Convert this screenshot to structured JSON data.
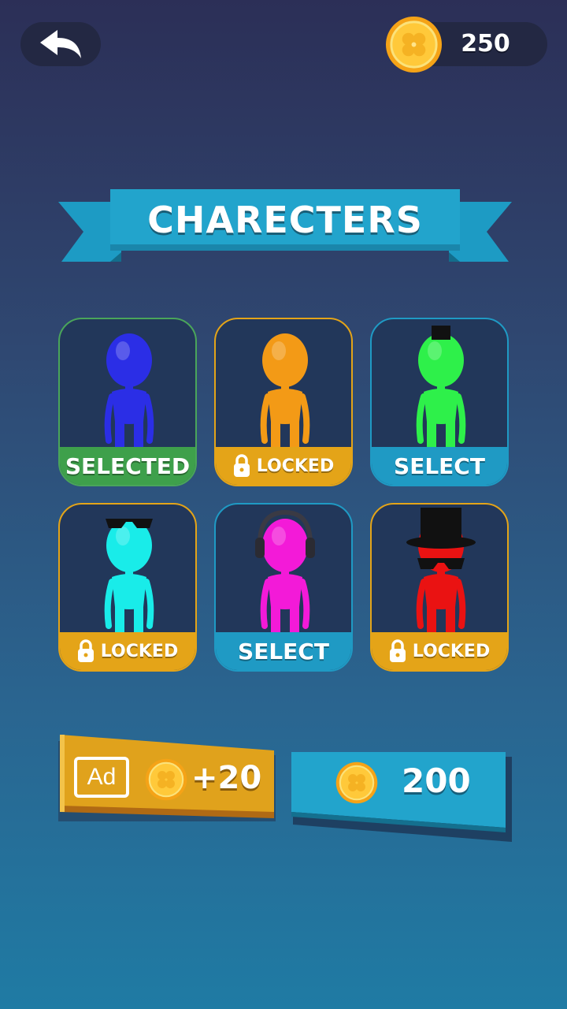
{
  "header": {
    "back_icon": "back-arrow-icon",
    "coins": "250",
    "coin_icon": "clover-coin-icon"
  },
  "banner": {
    "title": "CHARECTERS"
  },
  "characters": [
    {
      "color": "#2b2ee6",
      "accessory": "none",
      "status": "SELECTED",
      "status_color": "#3ea04b",
      "border": "#4aa55a"
    },
    {
      "color": "#f39a16",
      "accessory": "none",
      "status": "LOCKED",
      "status_color": "#e4a418",
      "border": "#e4a418"
    },
    {
      "color": "#2ef04a",
      "accessory": "small-hat",
      "status": "SELECT",
      "status_color": "#1f9ac4",
      "border": "#1f9ac4"
    },
    {
      "color": "#19ece9",
      "accessory": "sunglasses",
      "status": "LOCKED",
      "status_color": "#e4a418",
      "border": "#e4a418"
    },
    {
      "color": "#f31ad8",
      "accessory": "headphones",
      "status": "SELECT",
      "status_color": "#1f9ac4",
      "border": "#1f9ac4"
    },
    {
      "color": "#ea1212",
      "accessory": "top-hat-and-shades",
      "status": "LOCKED",
      "status_color": "#e4a418",
      "border": "#e4a418"
    }
  ],
  "ad_button": {
    "ad_label": "Ad",
    "reward": "+20"
  },
  "buy_button": {
    "price": "200"
  },
  "colors": {
    "lock_icon": "padlock-icon",
    "gold": "#e4a418",
    "blue": "#1f9ac4",
    "green": "#3ea04b"
  }
}
